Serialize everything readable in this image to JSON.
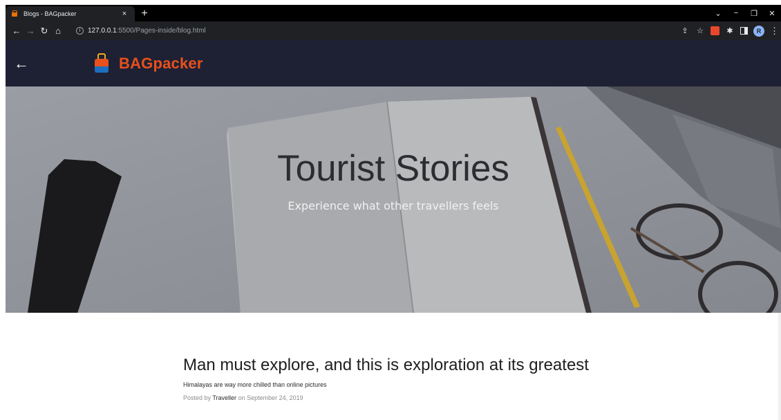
{
  "browser": {
    "tab_title": "Blogs - BAGpacker",
    "tab_close": "×",
    "new_tab": "+",
    "url_host": "127.0.0.1",
    "url_rest": ":5500/Pages-inside/blog.html",
    "avatar_letter": "R",
    "window_controls": {
      "chevron": "⌄",
      "minimize": "−",
      "restore": "❐",
      "close": "✕"
    }
  },
  "site": {
    "back_arrow": "←",
    "brand": "BAGpacker",
    "brand_color": "#e8501c",
    "header_color": "#1e2134"
  },
  "hero": {
    "title": "Tourist Stories",
    "subtitle": "Experience what other travellers feels"
  },
  "article": {
    "title": "Man must explore, and this is exploration at its greatest",
    "subtitle": "Himalayas are way more chilled than online pictures",
    "meta_prefix": "Posted by",
    "meta_author": "Traveller",
    "meta_date": "on September 24, 2019"
  }
}
